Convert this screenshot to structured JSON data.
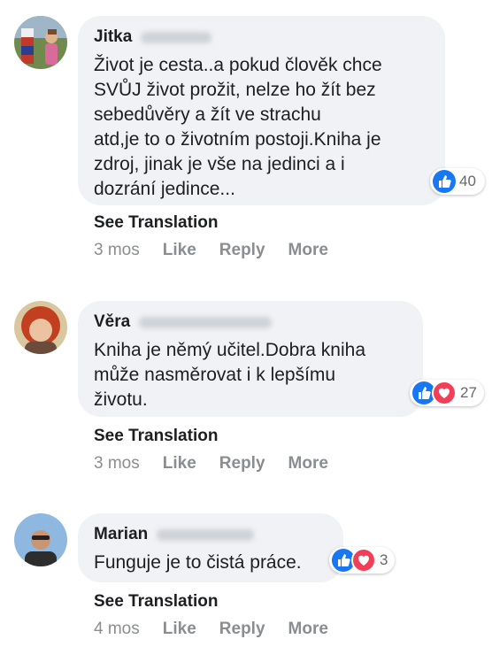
{
  "comments": [
    {
      "author": "Jitka",
      "text": "Život je cesta..a pokud člověk chce\nSVŮJ život prožit, nelze ho žít bez\nsebedůvěry a žít ve strachu\natd,je to o životním postoji.Kniha je\nzdroj, jinak je vše na jedinci a i\ndozrání jedince...",
      "reaction_count": "40",
      "reactions": [
        "like-icon"
      ],
      "see_translation": "See Translation",
      "time": "3 mos",
      "like": "Like",
      "reply": "Reply",
      "more": "More"
    },
    {
      "author": "Věra",
      "text": "Kniha je němý učitel.Dobra kniha\nmůže nasměrovat i k lepšímu\nživotu.",
      "reaction_count": "27",
      "reactions": [
        "like-icon",
        "love-icon"
      ],
      "see_translation": "See Translation",
      "time": "3 mos",
      "like": "Like",
      "reply": "Reply",
      "more": "More"
    },
    {
      "author": "Marian",
      "text": "Funguje je to čistá práce.",
      "reaction_count": "3",
      "reactions": [
        "like-icon",
        "love-icon"
      ],
      "see_translation": "See Translation",
      "time": "4 mos",
      "like": "Like",
      "reply": "Reply",
      "more": "More"
    }
  ],
  "colors": {
    "bubble": "#f0f2f5",
    "like_blue": "#1877f2",
    "love_red": "#f33e58",
    "meta_gray": "#8a8d91"
  }
}
